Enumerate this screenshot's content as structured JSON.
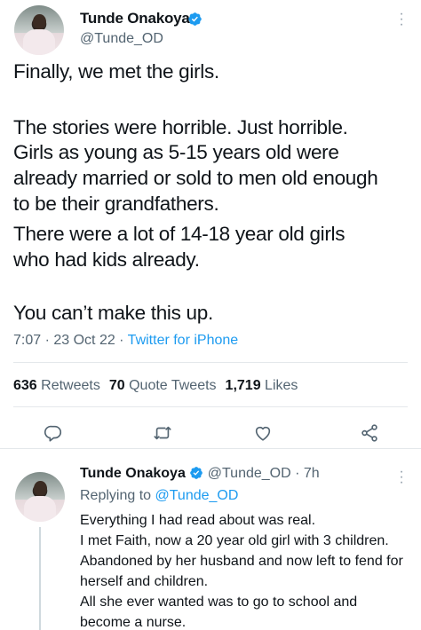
{
  "main_tweet": {
    "author": {
      "name": "Tunde Onakoya",
      "handle": "@Tunde_OD"
    },
    "text_lines": [
      "Finally, we met the girls.",
      "The stories were horrible. Just horrible.",
      "Girls as young as 5-15 years old were",
      "already married or sold to men old enough",
      "to be their grandfathers.",
      "There were a lot of 14-18 year old girls",
      "who had kids already.",
      "You can’t make this up."
    ],
    "time": "7:07 · 23 Oct 22 · ",
    "source": "Twitter for iPhone",
    "stats": {
      "retweets_count": "636",
      "retweets_label": "Retweets",
      "quotes_count": "70",
      "quotes_label": "Quote Tweets",
      "likes_count": "1,719",
      "likes_label": "Likes"
    },
    "actions": [
      "reply-icon",
      "retweet-icon",
      "like-icon",
      "share-icon"
    ]
  },
  "reply_tweet": {
    "author": {
      "name": "Tunde Onakoya",
      "handle": "@Tunde_OD",
      "age": " · 7h"
    },
    "replying_prefix": "Replying to ",
    "replying_to": "@Tunde_OD",
    "text_lines": [
      "Everything I had read about was real.",
      "I met Faith, now a 20 year old girl with 3 children.",
      "Abandoned by her husband and now left to fend for",
      "herself and children.",
      "All she ever wanted was to go to school and",
      "become a nurse."
    ]
  },
  "colors": {
    "accent": "#1d9bf0",
    "text": "#0f1419",
    "secondary": "#536471",
    "divider": "#e4e8eb"
  }
}
